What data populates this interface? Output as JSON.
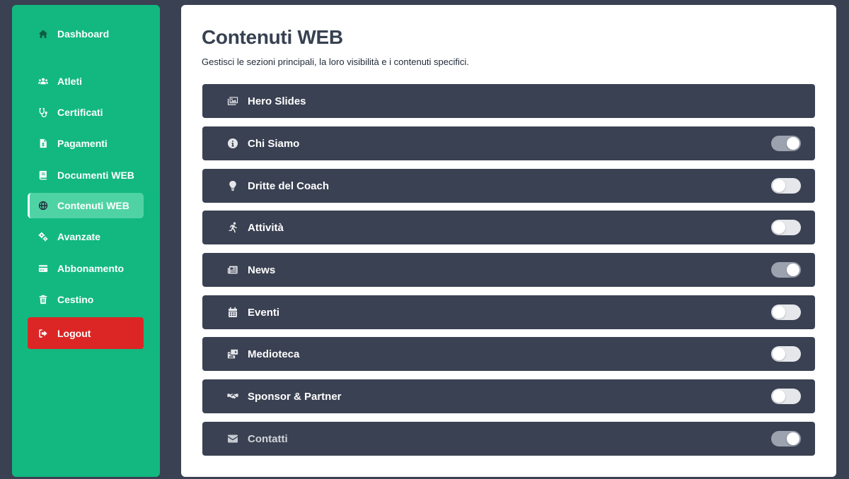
{
  "sidebar": {
    "items": [
      {
        "label": "Dashboard",
        "icon": "home-icon"
      },
      {
        "label": "Atleti",
        "icon": "users-icon"
      },
      {
        "label": "Certificati",
        "icon": "stethoscope-icon"
      },
      {
        "label": "Pagamenti",
        "icon": "invoice-icon"
      },
      {
        "label": "Documenti WEB",
        "icon": "book-icon"
      },
      {
        "label": "Contenuti WEB",
        "icon": "globe-icon",
        "active": true
      },
      {
        "label": "Avanzate",
        "icon": "gears-icon"
      },
      {
        "label": "Abbonamento",
        "icon": "credit-card-icon"
      },
      {
        "label": "Cestino",
        "icon": "trash-icon"
      }
    ],
    "logout_label": "Logout",
    "logout_icon": "logout-icon"
  },
  "main": {
    "title": "Contenuti WEB",
    "subtitle": "Gestisci le sezioni principali, la loro visibilità e i contenuti specifici.",
    "sections": [
      {
        "label": "Hero Slides",
        "icon": "images-icon",
        "has_toggle": false
      },
      {
        "label": "Chi Siamo",
        "icon": "info-circle-icon",
        "has_toggle": true,
        "enabled": true
      },
      {
        "label": "Dritte del Coach",
        "icon": "lightbulb-icon",
        "has_toggle": true,
        "enabled": false
      },
      {
        "label": "Attività",
        "icon": "running-icon",
        "has_toggle": true,
        "enabled": false
      },
      {
        "label": "News",
        "icon": "newspaper-icon",
        "has_toggle": true,
        "enabled": true
      },
      {
        "label": "Eventi",
        "icon": "calendar-icon",
        "has_toggle": true,
        "enabled": false
      },
      {
        "label": "Medioteca",
        "icon": "photo-video-icon",
        "has_toggle": true,
        "enabled": false
      },
      {
        "label": "Sponsor & Partner",
        "icon": "handshake-icon",
        "has_toggle": true,
        "enabled": false
      },
      {
        "label": "Contatti",
        "icon": "envelope-icon",
        "has_toggle": true,
        "enabled": true
      }
    ]
  },
  "colors": {
    "background": "#3a4152",
    "sidebar": "#12b880",
    "sidebar_active": "#4fd3a5",
    "logout": "#dc2626",
    "panel": "#ffffff",
    "row": "#3a4152",
    "toggle_on": "#9ca3af",
    "toggle_off": "#e5e7eb"
  }
}
